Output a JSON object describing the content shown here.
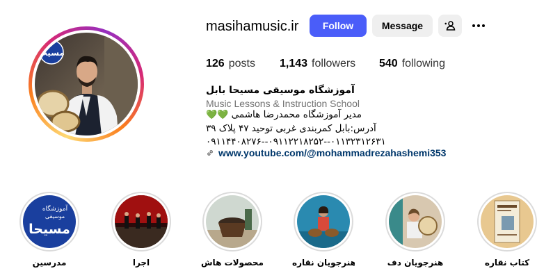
{
  "profile": {
    "username": "masihamusic.ir",
    "follow_label": "Follow",
    "message_label": "Message",
    "posts_count": "126",
    "posts_label": "posts",
    "followers_count": "1,143",
    "followers_label": "followers",
    "following_count": "540",
    "following_label": "following"
  },
  "avatar": {
    "logo_text": "مسیحا"
  },
  "bio": {
    "name": "آموزشگاه موسیقی مسیحا بابل",
    "category": "Music Lessons & Instruction School",
    "line1": "مدیر آموزشگاه محمدرضا هاشمی",
    "line1_hearts": "💚💚",
    "line2": "آدرس:بابل کمربندی غربی توحید ۴۷ پلاک ۳۹",
    "line3": "۰۱۱۳۲۳۱۲۶۳۱--۰۹۱۱۲۲۱۸۲۵۲--۰۹۱۱۴۴۰۸۲۷۶",
    "link": "www.youtube.com/@mohammadrezahashemi353"
  },
  "highlights": [
    {
      "label": "مدرسین",
      "logo_line1": "آموزشگاه",
      "logo_line2": "موسیقی",
      "logo_main": "مسیحا"
    },
    {
      "label": "اجرا"
    },
    {
      "label": "محصولات هاش..."
    },
    {
      "label": "هنرجویان نقاره"
    },
    {
      "label": "هنرجویان دف"
    },
    {
      "label": "کتاب نقاره"
    }
  ],
  "colors": {
    "follow": "#4a5df9",
    "link": "#00376b",
    "muted": "#737373",
    "heart": "#22c55e"
  }
}
